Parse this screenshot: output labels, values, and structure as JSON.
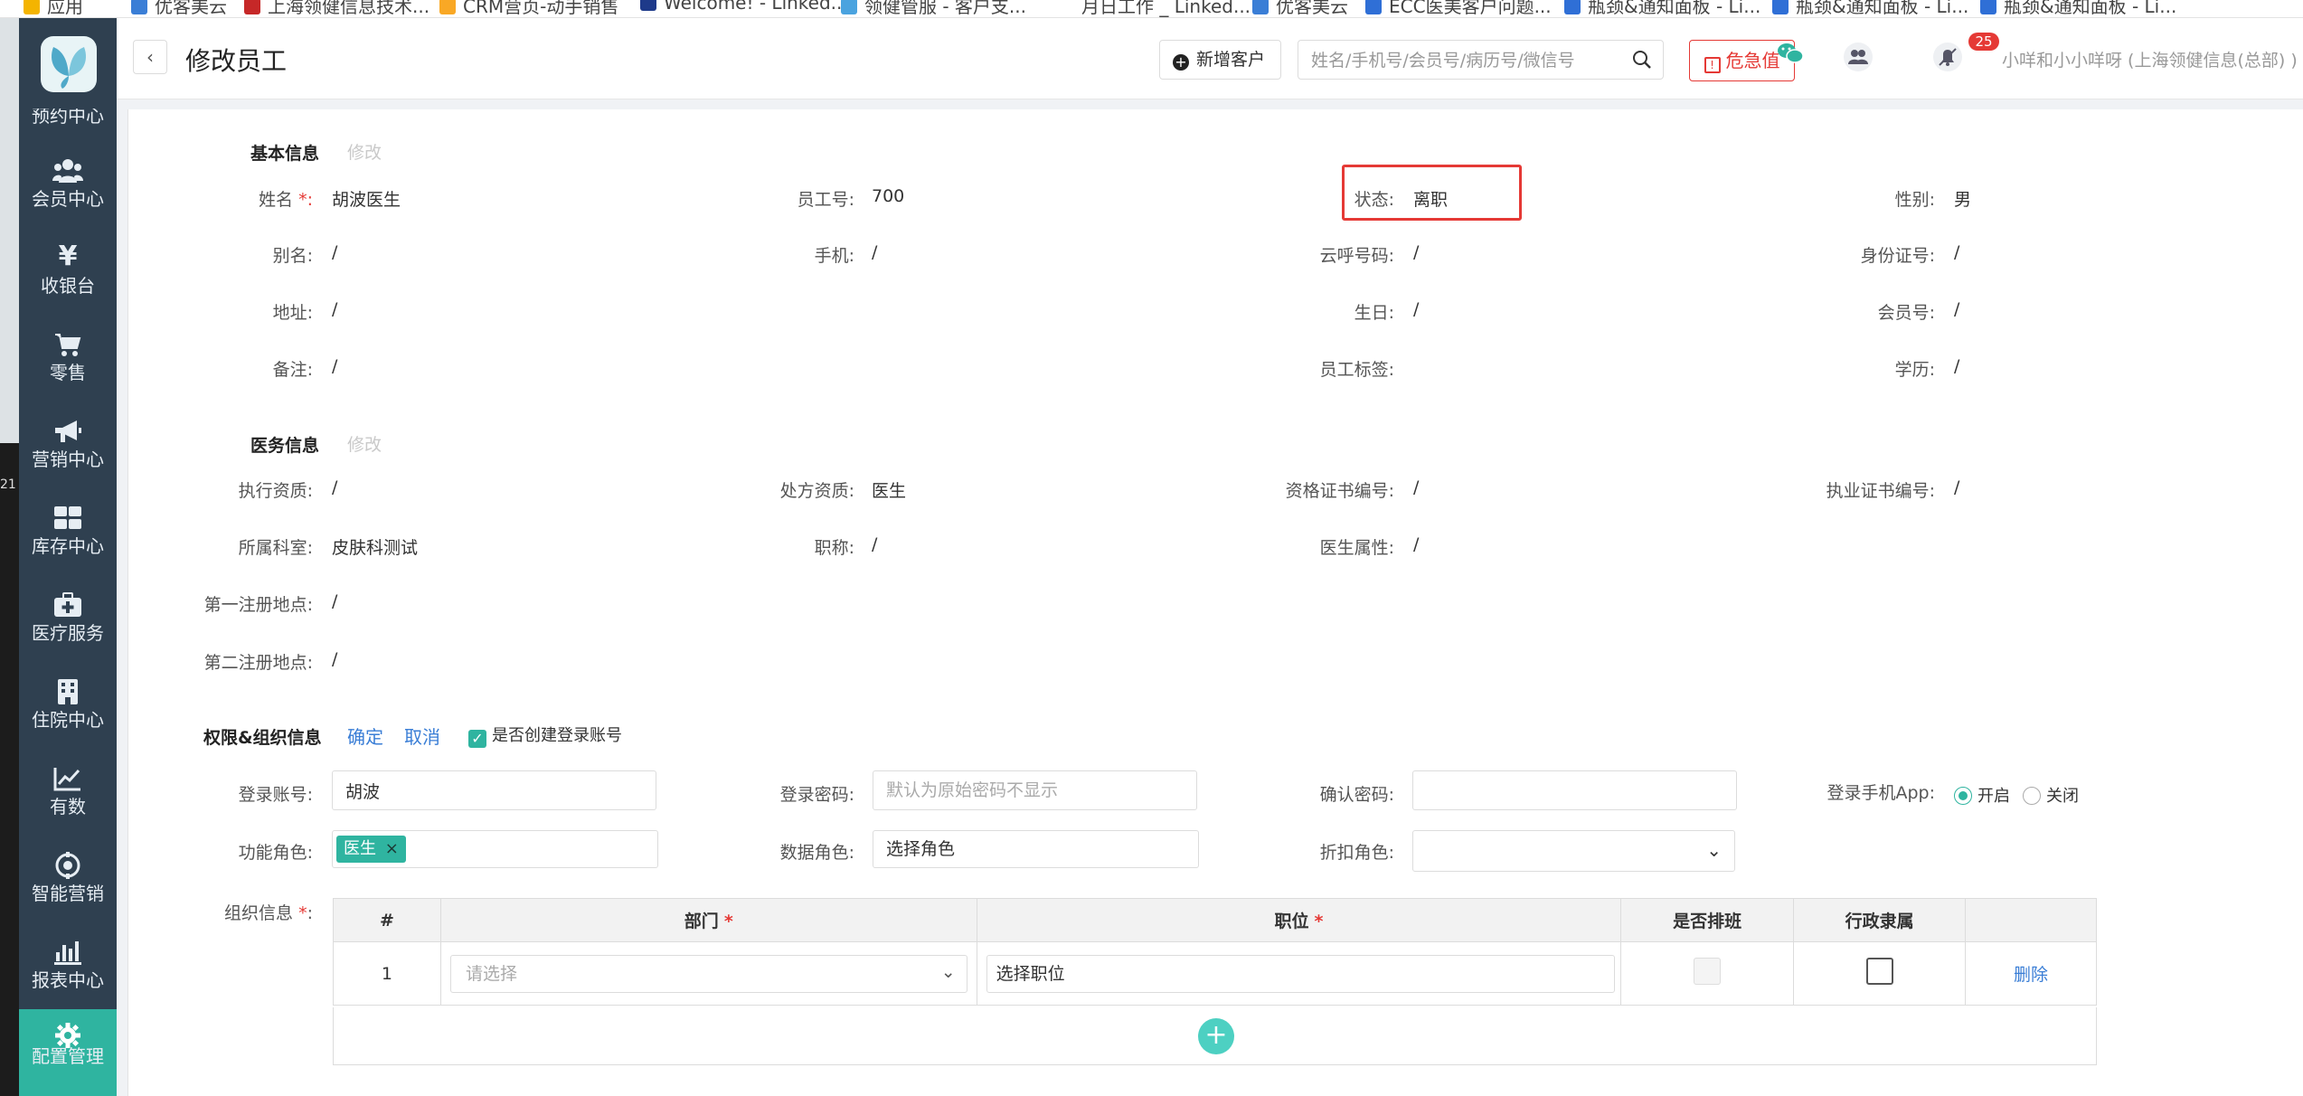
{
  "bookmarks": [
    "应用",
    "优客美云",
    "上海领健信息技术...",
    "CRM营页-动手销售",
    "Welcome! - Linked...",
    "领健管服 - 客户支...",
    "月日工作 _ Linked...",
    "优客美云",
    "ECC医美客户问题...",
    "瓶颈&通知面板 - Li...",
    "瓶颈&通知面板 - Li...",
    "瓶颈&通知面板 - Li..."
  ],
  "edge_number": "21",
  "sidebar": {
    "partial_item": "预约中心",
    "items": [
      {
        "label": "会员中心",
        "icon": "users-icon"
      },
      {
        "label": "收银台",
        "icon": "yen-icon"
      },
      {
        "label": "零售",
        "icon": "cart-icon"
      },
      {
        "label": "营销中心",
        "icon": "megaphone-icon"
      },
      {
        "label": "库存中心",
        "icon": "grid-icon"
      },
      {
        "label": "医疗服务",
        "icon": "medkit-icon"
      },
      {
        "label": "住院中心",
        "icon": "building-icon"
      },
      {
        "label": "有数",
        "icon": "trend-icon"
      },
      {
        "label": "智能营销",
        "icon": "target-icon"
      },
      {
        "label": "报表中心",
        "icon": "bar-chart-icon"
      },
      {
        "label": "配置管理",
        "icon": "gear-icon"
      }
    ]
  },
  "header": {
    "title": "修改员工",
    "add_customer": "新增客户",
    "search_placeholder": "姓名/手机号/会员号/病历号/微信号",
    "critical_value": "危急值",
    "notification_count": "25",
    "user": "小咩和小小咩呀 (上海领健信息(总部) )"
  },
  "basic_info": {
    "title": "基本信息",
    "edit": "修改",
    "fields": {
      "name_label": "姓名",
      "name": "胡波医生",
      "employee_no_label": "员工号:",
      "employee_no": "700",
      "status_label": "状态:",
      "status": "离职",
      "gender_label": "性别:",
      "gender": "男",
      "alias_label": "别名:",
      "alias": "/",
      "phone_label": "手机:",
      "phone": "/",
      "cloud_call_label": "云呼号码:",
      "cloud_call": "/",
      "id_card_label": "身份证号:",
      "id_card": "/",
      "address_label": "地址:",
      "address": "/",
      "birthday_label": "生日:",
      "birthday": "/",
      "member_no_label": "会员号:",
      "member_no": "/",
      "remark_label": "备注:",
      "remark": "/",
      "tags_label": "员工标签:",
      "education_label": "学历:",
      "education": "/"
    }
  },
  "medical_info": {
    "title": "医务信息",
    "edit": "修改",
    "fields": {
      "practice_qual_label": "执行资质:",
      "practice_qual": "/",
      "prescription_qual_label": "处方资质:",
      "prescription_qual": "医生",
      "cert_no_label": "资格证书编号:",
      "cert_no": "/",
      "license_no_label": "执业证书编号:",
      "license_no": "/",
      "department_label": "所属科室:",
      "department": "皮肤科测试",
      "job_title_label": "职称:",
      "job_title": "/",
      "doctor_attr_label": "医生属性:",
      "doctor_attr": "/",
      "first_reg_label": "第一注册地点:",
      "first_reg": "/",
      "second_reg_label": "第二注册地点:",
      "second_reg": "/"
    }
  },
  "permissions": {
    "title": "权限&组织信息",
    "confirm": "确定",
    "cancel": "取消",
    "create_account_label": "是否创建登录账号",
    "create_account_checked": true,
    "login_account_label": "登录账号:",
    "login_account": "胡波",
    "password_label": "登录密码:",
    "password_placeholder": "默认为原始密码不显示",
    "confirm_password_label": "确认密码:",
    "mobile_app_label": "登录手机App:",
    "mobile_app_on": "开启",
    "mobile_app_off": "关闭",
    "mobile_app_value": "开启",
    "func_role_label": "功能角色:",
    "func_role_tag": "医生",
    "data_role_label": "数据角色:",
    "data_role_value": "选择角色",
    "discount_role_label": "折扣角色:",
    "discount_role_value": "",
    "org_label": "组织信息",
    "table": {
      "headers": [
        "#",
        "部门",
        "职位",
        "是否排班",
        "行政隶属",
        ""
      ],
      "rows": [
        {
          "index": "1",
          "dept_placeholder": "请选择",
          "position_placeholder": "选择职位",
          "scheduling": false,
          "admin": false,
          "action": "删除"
        }
      ]
    }
  },
  "colors": {
    "sidebar_bg": "#2f4050",
    "accent": "#2fb4a0",
    "danger": "#e53935",
    "link": "#3a7ed6"
  }
}
